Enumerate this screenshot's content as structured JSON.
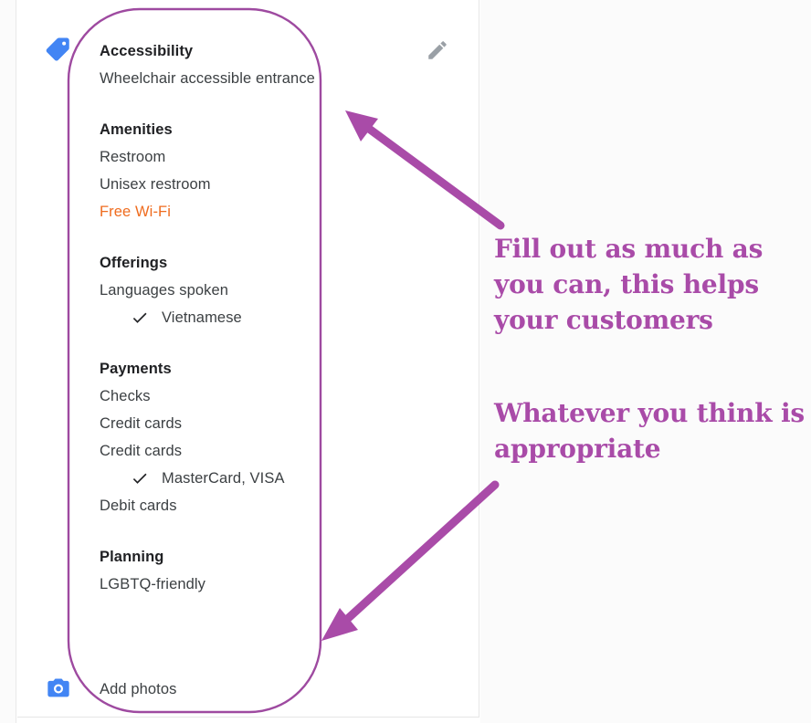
{
  "colors": {
    "annotation_purple": "#A94BA8",
    "outline_purple": "#9E4AA0",
    "icon_blue": "#4285F4",
    "pencil_gray": "#9AA0A6",
    "highlight_orange": "#EF6C1F",
    "text_primary": "#202124",
    "text_body": "#3C4043",
    "panel_background": "#FFFFFF",
    "right_background": "#FBFBFB"
  },
  "icons": {
    "tag": "tag-icon",
    "camera": "camera-icon",
    "pencil": "pencil-icon",
    "check": "check-icon"
  },
  "attributes": {
    "groups": [
      {
        "title": "Accessibility",
        "rows": [
          {
            "label": "Wheelchair accessible entrance",
            "highlight": false,
            "children": []
          }
        ]
      },
      {
        "title": "Amenities",
        "rows": [
          {
            "label": "Restroom",
            "highlight": false,
            "children": []
          },
          {
            "label": "Unisex restroom",
            "highlight": false,
            "children": []
          },
          {
            "label": "Free Wi-Fi",
            "highlight": true,
            "children": []
          }
        ]
      },
      {
        "title": "Offerings",
        "rows": [
          {
            "label": "Languages spoken",
            "highlight": false,
            "children": [
              "Vietnamese"
            ]
          }
        ]
      },
      {
        "title": "Payments",
        "rows": [
          {
            "label": "Checks",
            "highlight": false,
            "children": []
          },
          {
            "label": "Credit cards",
            "highlight": false,
            "children": []
          },
          {
            "label": "Credit cards",
            "highlight": false,
            "children": [
              "MasterCard, VISA"
            ]
          },
          {
            "label": "Debit cards",
            "highlight": false,
            "children": []
          }
        ]
      },
      {
        "title": "Planning",
        "rows": [
          {
            "label": "LGBTQ-friendly",
            "highlight": false,
            "children": []
          }
        ]
      }
    ]
  },
  "add_photos": {
    "label": "Add photos"
  },
  "annotations": {
    "note_1": "Fill out as much as you can, this helps your customers",
    "note_2": "Whatever you think is appropriate"
  }
}
